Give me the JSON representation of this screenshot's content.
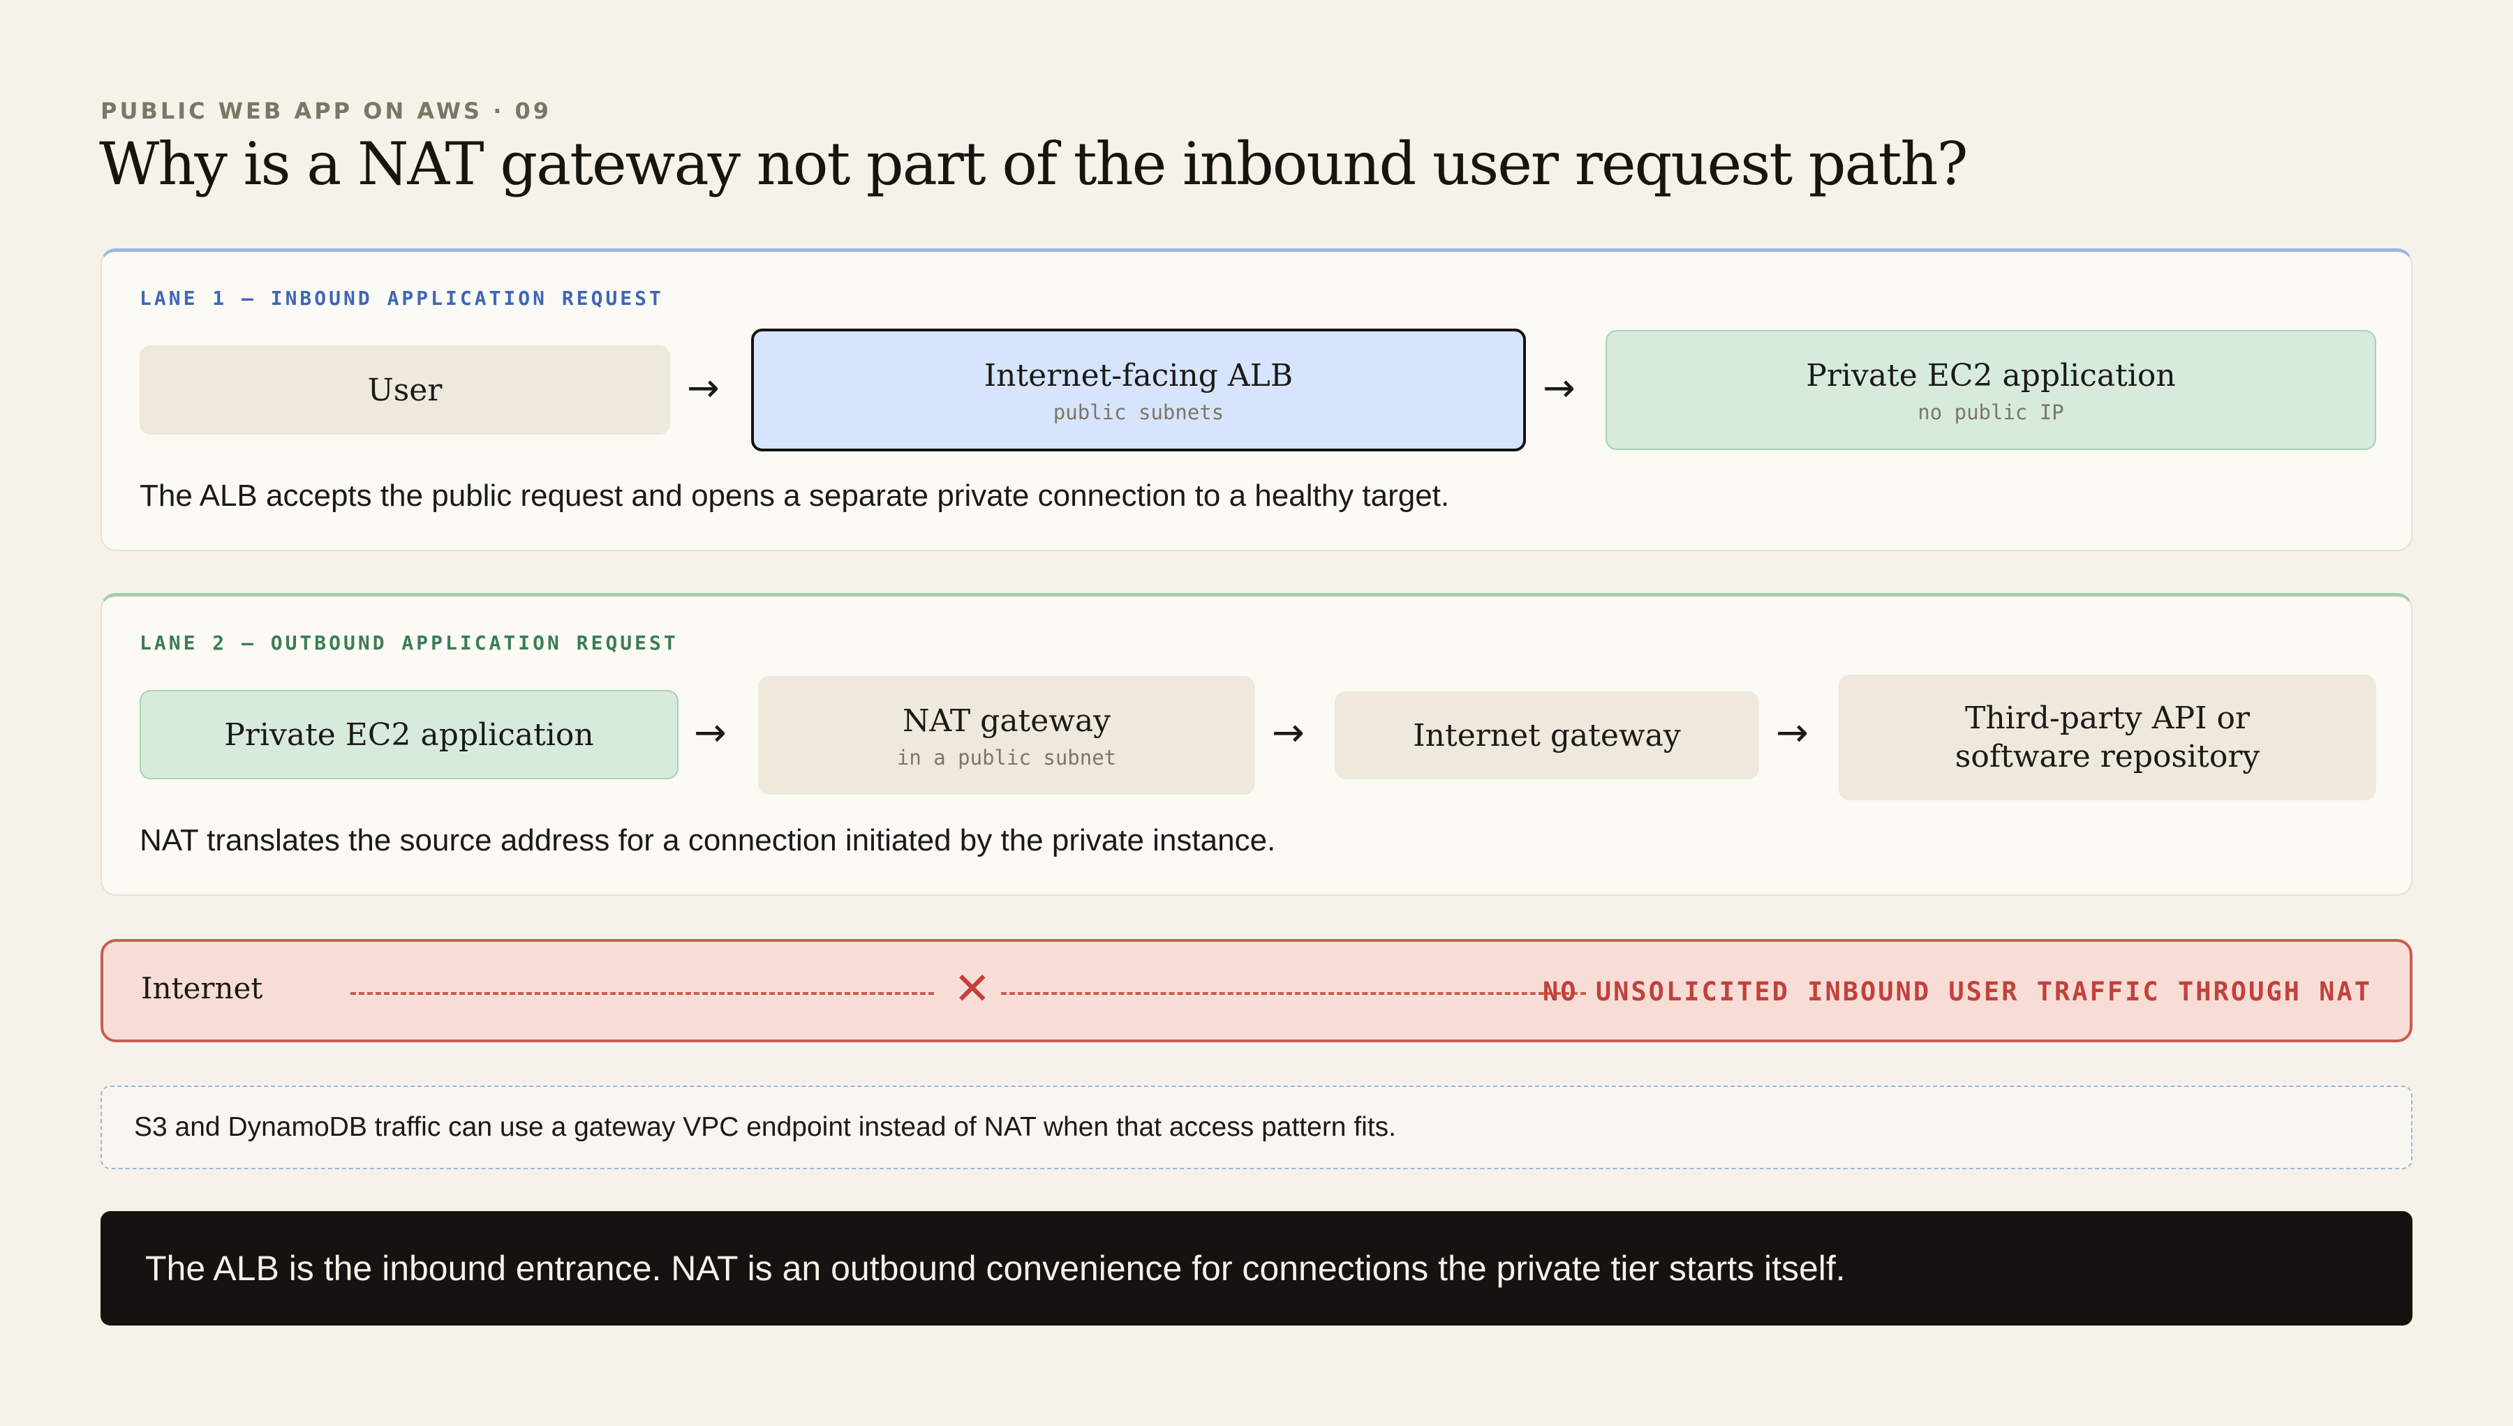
{
  "header": {
    "eyebrow": "PUBLIC WEB APP ON AWS · 09",
    "title": "Why is a NAT gateway not part of the inbound user request path?"
  },
  "lane1": {
    "label": "LANE 1 — INBOUND APPLICATION REQUEST",
    "nodes": [
      {
        "label": "User",
        "sub": ""
      },
      {
        "label": "Internet-facing ALB",
        "sub": "public subnets"
      },
      {
        "label": "Private EC2 application",
        "sub": "no public IP"
      }
    ],
    "arrow": "→",
    "caption": "The ALB accepts the public request and opens a separate private connection to a healthy target."
  },
  "lane2": {
    "label": "LANE 2 — OUTBOUND APPLICATION REQUEST",
    "nodes": [
      {
        "label": "Private EC2 application",
        "sub": ""
      },
      {
        "label": "NAT gateway",
        "sub": "in a public subnet"
      },
      {
        "label": "Internet gateway",
        "sub": ""
      },
      {
        "label": "Third-party API or software repository",
        "sub": ""
      }
    ],
    "arrow": "→",
    "caption": "NAT translates the source address for a connection initiated by the private instance."
  },
  "barrier": {
    "label": "Internet",
    "blocked_icon": "cross-icon",
    "blocked_glyph": "✕",
    "note": "NO UNSOLICITED INBOUND USER TRAFFIC THROUGH NAT"
  },
  "tip": {
    "text": "S3 and DynamoDB traffic can use a gateway VPC endpoint instead of NAT when that access pattern fits."
  },
  "takeaway": {
    "text": "The ALB is the inbound entrance. NAT is an outbound convenience for connections the private tier starts itself."
  },
  "colors": {
    "background": "#f6f2ea",
    "lane1_accent": "#3f66b8",
    "lane2_accent": "#3b7d52",
    "alb_fill": "#d6e5fd",
    "private_fill": "#d6ebdc",
    "neutral_fill": "#efe8dc",
    "warning": "#c2413a",
    "warning_fill": "#f8ddd7",
    "takeaway_fill": "#14130f"
  }
}
